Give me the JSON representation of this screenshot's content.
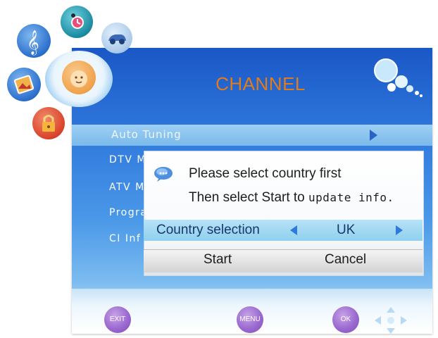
{
  "menu": {
    "title": "CHANNEL",
    "highlighted_item": "Auto Tuning",
    "items": [
      "DTV M",
      "ATV M",
      "Progra",
      "CI Inf"
    ]
  },
  "dialog": {
    "line1": "Please select country first",
    "line2_prefix": "Then select Start to ",
    "line2_suffix": "update info.",
    "country_label": "Country selection",
    "country_value": "UK",
    "start_label": "Start",
    "cancel_label": "Cancel"
  },
  "footer": {
    "exit_label": "EXIT",
    "menu_label": "MENU",
    "ok_label": "OK"
  },
  "icons": {
    "side_menu": [
      "music-note-icon",
      "clock-icon",
      "car-icon",
      "picture-icon",
      "face-icon",
      "lock-icon"
    ]
  },
  "colors": {
    "title": "#e27b1a",
    "panel": "#2f78dc",
    "highlight": "#8fd0ee",
    "key_button": "#9b6ad0"
  }
}
